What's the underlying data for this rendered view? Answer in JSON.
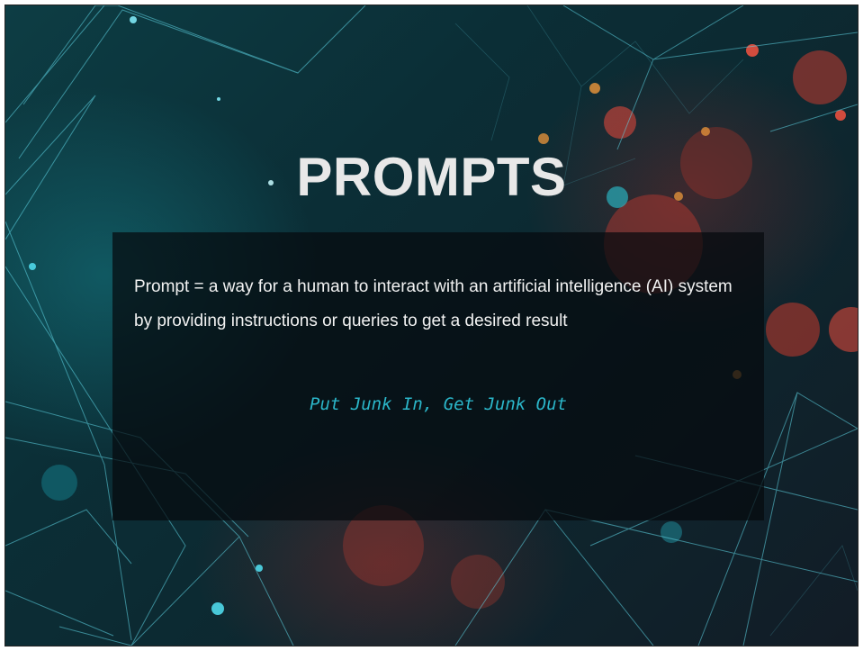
{
  "slide": {
    "title": "PROMPTS",
    "body": "Prompt =  a way for a human to interact with an artificial intelligence (AI) system by providing instructions or queries to get a desired result",
    "tagline": "Put Junk In, Get Junk Out"
  },
  "colors": {
    "title": "#e8e8e8",
    "body": "#f2f2f2",
    "tagline": "#2bb6c9",
    "box": "#050a0e",
    "network_lines": "#5fd6e6",
    "bokeh_red": "#e0403a",
    "bokeh_orange": "#e08a3a"
  },
  "background": {
    "description_icon": "network-lines-and-bokeh-dots"
  }
}
